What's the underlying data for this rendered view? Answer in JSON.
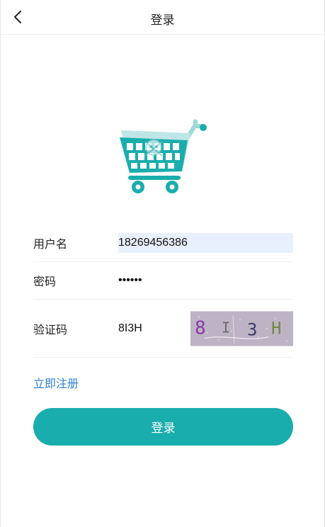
{
  "header": {
    "title": "登录",
    "back_icon": "chevron-left-icon"
  },
  "logo": {
    "icon": "shopping-cart-icon",
    "color": "#1aadad"
  },
  "form": {
    "username": {
      "label": "用户名",
      "value": "18269456386"
    },
    "password": {
      "label": "密码",
      "value": "qwerty"
    },
    "captcha": {
      "label": "验证码",
      "value": "8I3H",
      "image_text": "8 I 3 H"
    }
  },
  "register_link": "立即注册",
  "login_button": "登录",
  "colors": {
    "accent": "#1aadad",
    "link": "#2e7fd2",
    "autofill": "#e8f0fe"
  }
}
